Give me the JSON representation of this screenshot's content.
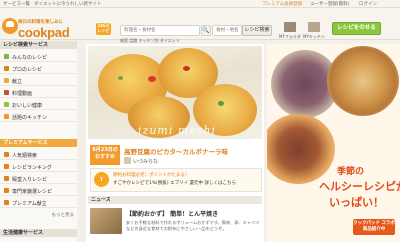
{
  "topbar": {
    "left_links": [
      "サービス一覧",
      "ダイエットに今うれしい新サイト"
    ],
    "premium": "プレミアム会員登録",
    "register": "ユーザー登録(無料)",
    "login": "ログイン"
  },
  "header": {
    "tagline": "毎日の料理を楽しみに",
    "logo": "cookpad",
    "badge": "246万レシピ",
    "search_placeholder": "料理名・食材名",
    "search_icon_label": "🔍",
    "search2_placeholder": "食材・地名",
    "recipe_search": "レシピ検索",
    "sub_links": "検索 話題 キッチン別 ダイエット",
    "myfolder": "MYフォルダ",
    "mykitchen": "MYキッチン",
    "post_button": "レシピをのせる"
  },
  "sidebar": {
    "sections": [
      {
        "title": "レシピ検索サービス",
        "premium": false,
        "items": [
          {
            "label": "みんなのレシピ",
            "color": "#7fb24a"
          },
          {
            "label": "プロのレシピ",
            "color": "#e0821e"
          },
          {
            "label": "献立",
            "color": "#f0a93a"
          },
          {
            "label": "料理動画",
            "color": "#d04a3a"
          },
          {
            "label": "おいしい健康",
            "color": "#8cc63f"
          },
          {
            "label": "話題のキッチン",
            "color": "#f39a2c"
          }
        ]
      },
      {
        "title": "プレミアムサービス",
        "premium": true,
        "items": [
          {
            "label": "人気順検索",
            "color": "#e0821e"
          },
          {
            "label": "レシピランキング",
            "color": "#e0821e"
          },
          {
            "label": "殿堂入りレシピ",
            "color": "#e0821e"
          },
          {
            "label": "専門家厳選レシピ",
            "color": "#e0821e"
          },
          {
            "label": "プレミアム献立",
            "color": "#e0821e"
          }
        ],
        "more": "もっと見る"
      },
      {
        "title": "生活健康サービス",
        "premium": false,
        "items": []
      }
    ]
  },
  "featured": {
    "watermark": "izumi meshi",
    "date": "8月23日の",
    "date_sub": "おすすめ",
    "title": "高野豆腐のピカタ～カルボナーラ味",
    "author": "いづみらな"
  },
  "promo": {
    "icon_text": "T",
    "line1": "節約お料理必見！ポイントがたまる！",
    "line2": "すごやかレシピで1%(税抜) エブリイ 還元中 詳しくはこちら"
  },
  "news": {
    "heading": "ニュース",
    "title": "【節約おかず】 簡単！とん平焼き",
    "body": "安くお手軽な材料で作れるボリュームおかずです。豚肉、卵、キャベツなどの身近な食材でお財布にやさしい一品をどうぞ。"
  },
  "ad": {
    "line1": "季節の",
    "line2": "ヘルシーレシピが",
    "line3": "いっぱい！",
    "cta": "クックパッド コラボ商品紹介中"
  }
}
